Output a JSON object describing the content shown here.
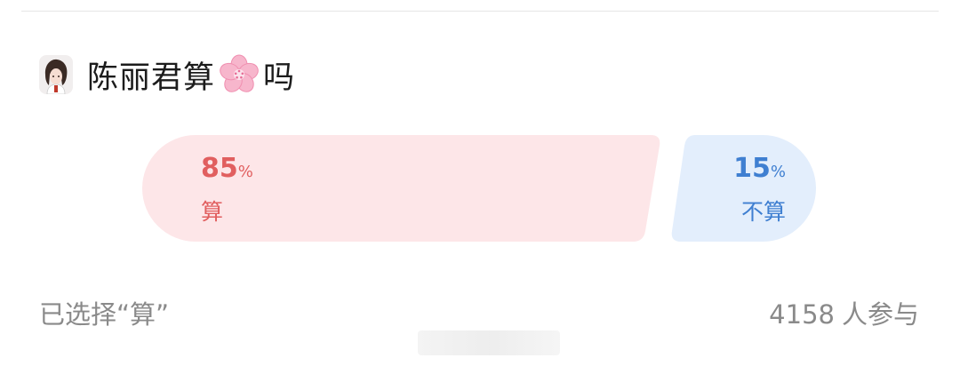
{
  "post": {
    "title": "陈丽君算",
    "title_suffix": "吗",
    "flower_icon": "cherry-blossom-icon"
  },
  "poll": {
    "options": [
      {
        "percent": 85,
        "percent_text": "85",
        "unit": "%",
        "label": "算",
        "color": "#e15f5f",
        "bg": "#fde6e8"
      },
      {
        "percent": 15,
        "percent_text": "15",
        "unit": "%",
        "label": "不算",
        "color": "#3f7fd1",
        "bg": "#e3eefc"
      }
    ],
    "selected_text": "已选择“算”",
    "participants_count": "4158",
    "participants_suffix": "人参与"
  },
  "colors": {
    "yes_bg": "#fde6e8",
    "no_bg": "#e3eefc",
    "muted_text": "#8a8a8a"
  }
}
